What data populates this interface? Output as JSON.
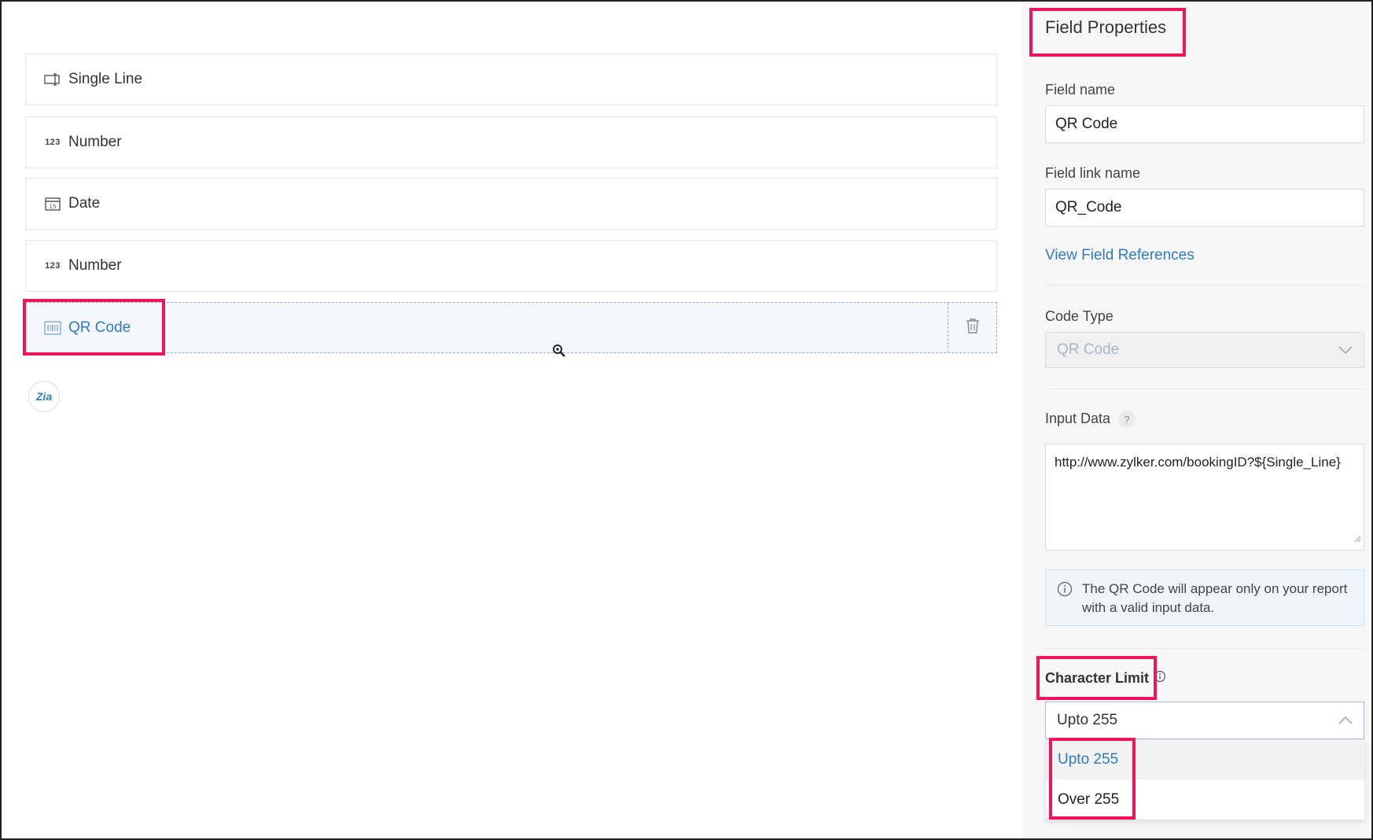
{
  "canvas": {
    "fields": [
      {
        "label": "Single Line",
        "icon": "single-line-icon"
      },
      {
        "label": "Number",
        "icon": "number-icon"
      },
      {
        "label": "Date",
        "icon": "calendar-icon"
      },
      {
        "label": "Number",
        "icon": "number-icon"
      },
      {
        "label": "QR Code",
        "icon": "qr-code-icon",
        "selected": true
      }
    ],
    "number_icon_text": "123",
    "zia_text": "Zia"
  },
  "panel": {
    "title": "Field Properties",
    "field_name_label": "Field name",
    "field_name_value": "QR Code",
    "field_link_label": "Field link name",
    "field_link_value": "QR_Code",
    "view_refs_link": "View Field References",
    "code_type_label": "Code Type",
    "code_type_value": "QR Code",
    "input_data_label": "Input Data",
    "input_data_help": "?",
    "input_data_value": "http://www.zylker.com/bookingID?${Single_Line}",
    "info_text": "The QR Code will appear only on your report with a valid input data.",
    "char_limit_label": "Character Limit",
    "char_limit_value": "Upto 255",
    "char_limit_options": [
      "Upto 255",
      "Over 255"
    ]
  },
  "colors": {
    "accent": "#2f7bc4",
    "highlight": "#f0145a"
  }
}
